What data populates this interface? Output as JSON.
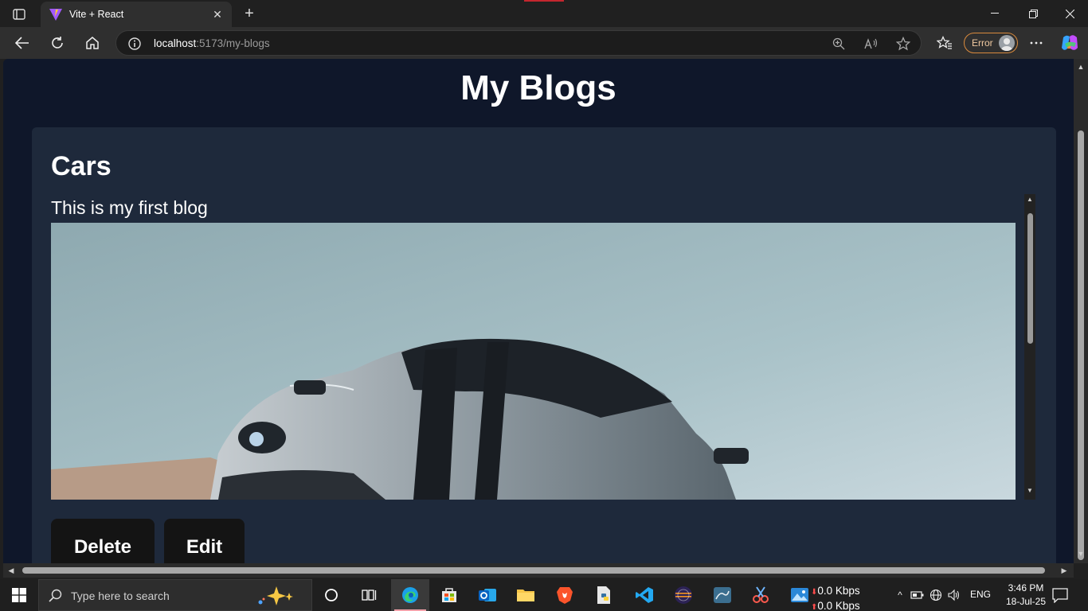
{
  "browser": {
    "tab": {
      "title": "Vite + React"
    },
    "address": {
      "host": "localhost",
      "path": ":5173/my-blogs"
    },
    "profile_status": "Error"
  },
  "page": {
    "title": "My Blogs",
    "blogs": [
      {
        "title": "Cars",
        "description": "This is my first blog",
        "image_alt": "car-photo",
        "buttons": {
          "delete": "Delete",
          "edit": "Edit"
        }
      }
    ]
  },
  "taskbar": {
    "search_placeholder": "Type here to search",
    "net_down": "0.0 Kbps",
    "net_up": "0.0 Kbps",
    "language": "ENG",
    "time": "3:46 PM",
    "date": "18-Jul-25"
  },
  "colors": {
    "page_bg": "#0f172a",
    "card_bg": "#1e293b",
    "button_bg": "#141414",
    "error_pill": "#d98a3d"
  }
}
